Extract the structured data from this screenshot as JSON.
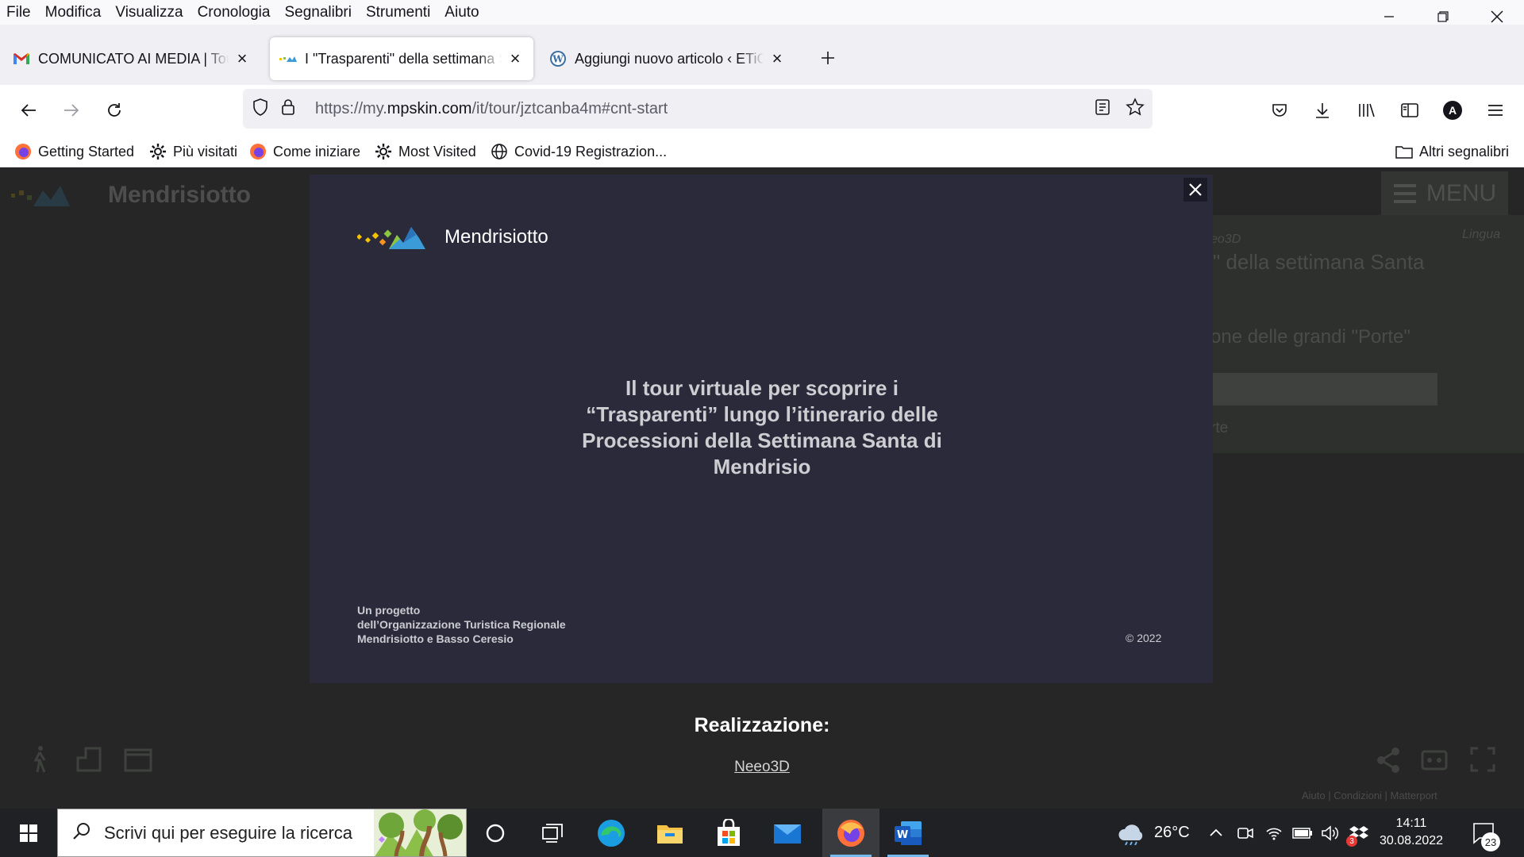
{
  "menubar": {
    "items": [
      {
        "label": "File",
        "key": "F"
      },
      {
        "label": "Modifica",
        "key": "M"
      },
      {
        "label": "Visualizza",
        "key": "V"
      },
      {
        "label": "Cronologia",
        "key": "C"
      },
      {
        "label": "Segnalibri",
        "key": "S"
      },
      {
        "label": "Strumenti",
        "key": "S"
      },
      {
        "label": "Aiuto",
        "key": "A"
      }
    ]
  },
  "tabs": [
    {
      "title": "COMUNICATO AI MEDIA | Tour virtuale",
      "icon": "gmail-icon"
    },
    {
      "title": "I \"Trasparenti\" della settimana Santa",
      "icon": "mendrisiotto-icon"
    },
    {
      "title": "Aggiungi nuovo articolo ‹ ETiCinema",
      "icon": "wordpress-icon"
    }
  ],
  "navbar": {
    "url_prefix": "https://my.",
    "url_domain": "mpskin.com",
    "url_suffix": "/it/tour/jztcanba4m#cnt-start",
    "profile_letter": "A"
  },
  "bookmarks": [
    {
      "label": "Getting Started",
      "icon": "firefox-icon"
    },
    {
      "label": "Più visitati",
      "icon": "gear-icon"
    },
    {
      "label": "Come iniziare",
      "icon": "firefox-icon"
    },
    {
      "label": "Most Visited",
      "icon": "gear-icon"
    },
    {
      "label": "Covid-19 Registrazion...",
      "icon": "globe-icon"
    }
  ],
  "bookmarks_other": "Altri segnalibri",
  "page": {
    "bg_logo": "Mendrisiotto",
    "bg_menu": "MENU",
    "bg_neeo": "eo3D",
    "bg_title": "ti\" della settimana Santa",
    "bg_lingua": "Lingua",
    "bg_subtitle": "one delle grandi \"Porte\"",
    "bg_rte": "rte",
    "bg_footer": "Aiuto  |  Condizioni  |  Matterport"
  },
  "modal": {
    "logo_text": "Mendrisiotto",
    "headline": "Il tour virtuale per scoprire i “Trasparenti” lungo l’itinerario delle Processioni della Settimana Santa di Mendrisio",
    "project_line1": "Un progetto",
    "project_line2": "dell’Organizzazione Turistica Regionale",
    "project_line3": "Mendrisiotto e Basso Ceresio",
    "copyright": "© 2022"
  },
  "credits": {
    "title": "Realizzazione:",
    "link": "Neeo3D"
  },
  "taskbar": {
    "search_placeholder": "Scrivi qui per eseguire la ricerca",
    "weather": "26°C",
    "time": "14:11",
    "date": "30.08.2022",
    "notifications": "23",
    "dropbox_badge": "3"
  },
  "colors": {
    "modal_bg": "#2b2a3b",
    "page_bg": "#252625",
    "accent": "#0060df"
  }
}
